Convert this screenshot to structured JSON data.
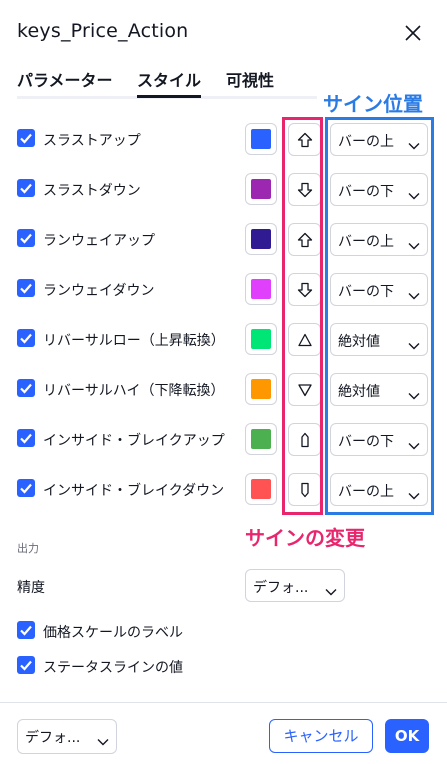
{
  "dialog": {
    "title": "keys_Price_Action"
  },
  "tabs": [
    {
      "label": "パラメーター",
      "active": false
    },
    {
      "label": "スタイル",
      "active": true
    },
    {
      "label": "可視性",
      "active": false
    }
  ],
  "rows": [
    {
      "label": "スラストアップ",
      "checked": true,
      "color": "#2962ff",
      "shape": "arrow-up-icon",
      "position": "バーの上"
    },
    {
      "label": "スラストダウン",
      "checked": true,
      "color": "#9c27b0",
      "shape": "arrow-down-icon",
      "position": "バーの下"
    },
    {
      "label": "ランウェイアップ",
      "checked": true,
      "color": "#311b92",
      "shape": "arrow-up-icon",
      "position": "バーの上"
    },
    {
      "label": "ランウェイダウン",
      "checked": true,
      "color": "#e040fb",
      "shape": "arrow-down-icon",
      "position": "バーの下"
    },
    {
      "label": "リバーサルロー（上昇転換）",
      "checked": true,
      "color": "#00e676",
      "shape": "triangle-up-icon",
      "position": "絶対値"
    },
    {
      "label": "リバーサルハイ（下降転換）",
      "checked": true,
      "color": "#ff9800",
      "shape": "triangle-down-icon",
      "position": "絶対値"
    },
    {
      "label": "インサイド・ブレイクアップ",
      "checked": true,
      "color": "#4caf50",
      "shape": "label-up-icon",
      "position": "バーの下"
    },
    {
      "label": "インサイド・ブレイクダウン",
      "checked": true,
      "color": "#ff5252",
      "shape": "label-down-icon",
      "position": "バーの上"
    }
  ],
  "annotations": {
    "position_label": "サイン位置",
    "shape_label": "サインの変更",
    "shape_color": "#e8266d",
    "position_color": "#2a7be4"
  },
  "output": {
    "section_title": "出力",
    "precision_label": "精度",
    "precision_value": "デフォ...",
    "checkboxes": [
      {
        "label": "価格スケールのラベル",
        "checked": true
      },
      {
        "label": "ステータスラインの値",
        "checked": true
      }
    ]
  },
  "footer": {
    "template_value": "デフォ...",
    "cancel_label": "キャンセル",
    "ok_label": "OK"
  },
  "colors": {
    "accent": "#2962ff",
    "text": "#131722"
  }
}
